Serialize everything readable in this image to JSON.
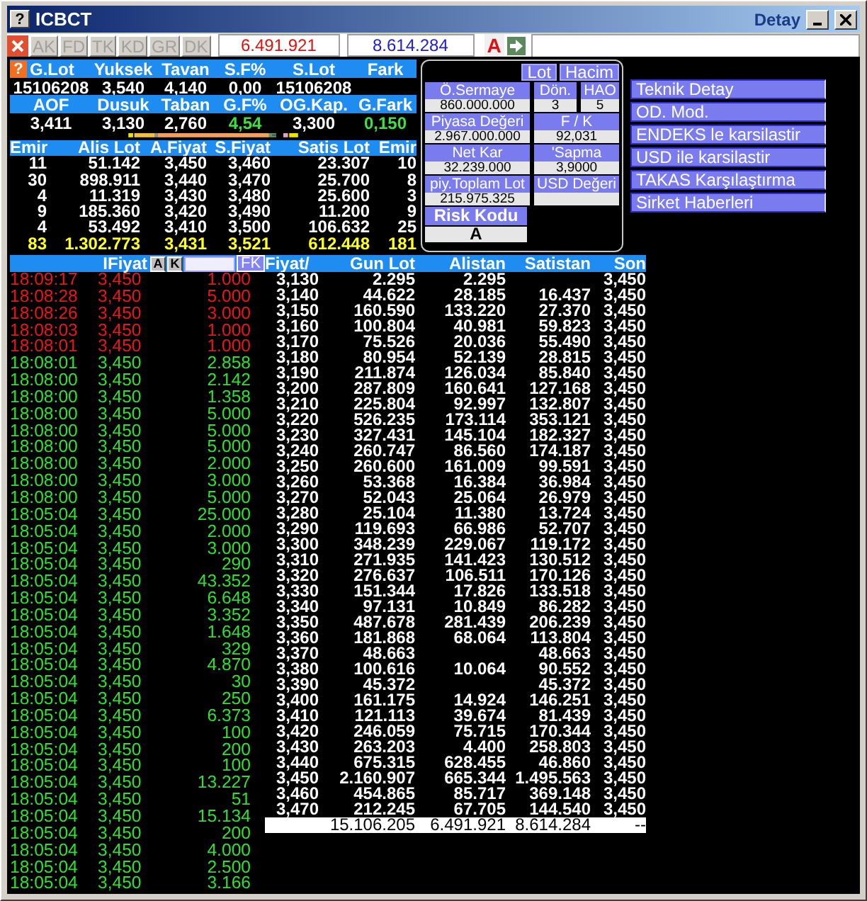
{
  "window": {
    "help": "?",
    "title": "ICBCT",
    "subtitle": "Detay"
  },
  "summary_help": "?",
  "toolbar": {
    "buttons": [
      {
        "label": "AK",
        "disabled": true
      },
      {
        "label": "FD",
        "disabled": true
      },
      {
        "label": "TK",
        "disabled": true
      },
      {
        "label": "KD",
        "disabled": true
      },
      {
        "label": "GR",
        "disabled": true
      },
      {
        "label": "DK",
        "disabled": true
      }
    ],
    "buy_total": "6.491.921",
    "sell_total": "8.614.284",
    "flag": "A"
  },
  "summary": [
    {
      "headers": [
        "G.Lot",
        "Yuksek",
        "Tavan",
        "S.F%",
        "S.Lot",
        "Fark"
      ],
      "values": [
        {
          "text": "15106208",
          "kind": "plain"
        },
        {
          "text": "3,540",
          "kind": "plain"
        },
        {
          "text": "4,140",
          "kind": "plain"
        },
        {
          "text": "0,00",
          "kind": "plain"
        },
        {
          "text": "15106208",
          "kind": "plain"
        }
      ]
    },
    {
      "headers": [
        "AOF",
        "Dusuk",
        "Taban",
        "G.F%",
        "OG.Kap.",
        "G.Fark"
      ],
      "values": [
        {
          "text": "3,411",
          "kind": "plain"
        },
        {
          "text": "3,130",
          "kind": "plain"
        },
        {
          "text": "2,760",
          "kind": "plain"
        },
        {
          "text": "4,54",
          "kind": "up"
        },
        {
          "text": "3,300",
          "kind": "plain"
        },
        {
          "text": "0,150",
          "kind": "up"
        }
      ]
    }
  ],
  "depth": {
    "columns": [
      "Emir",
      "Alis Lot",
      "A.Fiyat",
      "S.Fiyat",
      "Satis Lot",
      "Emir"
    ],
    "rows": [
      [
        "11",
        "51.142",
        "3,450",
        "3,460",
        "23.307",
        "10"
      ],
      [
        "30",
        "898.911",
        "3,440",
        "3,470",
        "25.700",
        "8"
      ],
      [
        "4",
        "11.319",
        "3,430",
        "3,480",
        "25.600",
        "3"
      ],
      [
        "9",
        "185.360",
        "3,420",
        "3,490",
        "11.200",
        "9"
      ],
      [
        "4",
        "53.492",
        "3,410",
        "3,500",
        "106.632",
        "25"
      ]
    ],
    "total": [
      "83",
      "1.302.773",
      "3,431",
      "3,521",
      "612.448",
      "181"
    ]
  },
  "info_panel": {
    "toggles": [
      "Lot",
      "Hacim"
    ],
    "rows": [
      [
        {
          "label": "Ö.Sermaye",
          "value": "860.000.000"
        },
        {
          "label": "Dön.",
          "value": "3"
        },
        {
          "label": "HAO",
          "value": "5"
        }
      ],
      [
        {
          "label": "Piyasa Değeri",
          "value": "2.967.000.000"
        },
        {
          "label": "F / K",
          "value": "92,031"
        }
      ],
      [
        {
          "label": "Net Kar",
          "value": "32.239.000"
        },
        {
          "label": "'Sapma",
          "value": "3,9000"
        }
      ],
      [
        {
          "label": "piy.Toplam Lot",
          "value": "215.975.325"
        },
        {
          "label": "USD Değeri"
        }
      ]
    ],
    "risk": {
      "label": "Risk Kodu",
      "value": "A"
    }
  },
  "menu": [
    "Teknik Detay",
    "OD. Mod.",
    "ENDEKS le karsilastir",
    "USD ile karsilastir",
    "TAKAS Karşılaştırma",
    "Sirket Haberleri"
  ],
  "trades": {
    "header": "IFiyat",
    "buttons": [
      "A",
      "K"
    ],
    "filter_button": "FK",
    "rows": [
      {
        "time": "18:09:17",
        "price": "3,450",
        "lot": "1.000",
        "kind": "sell"
      },
      {
        "time": "18:08:28",
        "price": "3,450",
        "lot": "5.000",
        "kind": "sell"
      },
      {
        "time": "18:08:26",
        "price": "3,450",
        "lot": "3.000",
        "kind": "sell"
      },
      {
        "time": "18:08:03",
        "price": "3,450",
        "lot": "1.000",
        "kind": "sell"
      },
      {
        "time": "18:08:01",
        "price": "3,450",
        "lot": "1.000",
        "kind": "sell"
      },
      {
        "time": "18:08:01",
        "price": "3,450",
        "lot": "2.858",
        "kind": "buy"
      },
      {
        "time": "18:08:00",
        "price": "3,450",
        "lot": "2.142",
        "kind": "buy"
      },
      {
        "time": "18:08:00",
        "price": "3,450",
        "lot": "1.358",
        "kind": "buy"
      },
      {
        "time": "18:08:00",
        "price": "3,450",
        "lot": "5.000",
        "kind": "buy"
      },
      {
        "time": "18:08:00",
        "price": "3,450",
        "lot": "5.000",
        "kind": "buy"
      },
      {
        "time": "18:08:00",
        "price": "3,450",
        "lot": "5.000",
        "kind": "buy"
      },
      {
        "time": "18:08:00",
        "price": "3,450",
        "lot": "2.000",
        "kind": "buy"
      },
      {
        "time": "18:08:00",
        "price": "3,450",
        "lot": "3.000",
        "kind": "buy"
      },
      {
        "time": "18:08:00",
        "price": "3,450",
        "lot": "5.000",
        "kind": "buy"
      },
      {
        "time": "18:05:04",
        "price": "3,450",
        "lot": "25.000",
        "kind": "buy"
      },
      {
        "time": "18:05:04",
        "price": "3,450",
        "lot": "2.000",
        "kind": "buy"
      },
      {
        "time": "18:05:04",
        "price": "3,450",
        "lot": "3.000",
        "kind": "buy"
      },
      {
        "time": "18:05:04",
        "price": "3,450",
        "lot": "290",
        "kind": "buy"
      },
      {
        "time": "18:05:04",
        "price": "3,450",
        "lot": "43.352",
        "kind": "buy"
      },
      {
        "time": "18:05:04",
        "price": "3,450",
        "lot": "6.648",
        "kind": "buy"
      },
      {
        "time": "18:05:04",
        "price": "3,450",
        "lot": "3.352",
        "kind": "buy"
      },
      {
        "time": "18:05:04",
        "price": "3,450",
        "lot": "1.648",
        "kind": "buy"
      },
      {
        "time": "18:05:04",
        "price": "3,450",
        "lot": "329",
        "kind": "buy"
      },
      {
        "time": "18:05:04",
        "price": "3,450",
        "lot": "4.870",
        "kind": "buy"
      },
      {
        "time": "18:05:04",
        "price": "3,450",
        "lot": "30",
        "kind": "buy"
      },
      {
        "time": "18:05:04",
        "price": "3,450",
        "lot": "250",
        "kind": "buy"
      },
      {
        "time": "18:05:04",
        "price": "3,450",
        "lot": "6.373",
        "kind": "buy"
      },
      {
        "time": "18:05:04",
        "price": "3,450",
        "lot": "100",
        "kind": "buy"
      },
      {
        "time": "18:05:04",
        "price": "3,450",
        "lot": "200",
        "kind": "buy"
      },
      {
        "time": "18:05:04",
        "price": "3,450",
        "lot": "100",
        "kind": "buy"
      },
      {
        "time": "18:05:04",
        "price": "3,450",
        "lot": "13.227",
        "kind": "buy"
      },
      {
        "time": "18:05:04",
        "price": "3,450",
        "lot": "51",
        "kind": "buy"
      },
      {
        "time": "18:05:04",
        "price": "3,450",
        "lot": "15.134",
        "kind": "buy"
      },
      {
        "time": "18:05:04",
        "price": "3,450",
        "lot": "200",
        "kind": "buy"
      },
      {
        "time": "18:05:04",
        "price": "3,450",
        "lot": "4.000",
        "kind": "buy"
      },
      {
        "time": "18:05:04",
        "price": "3,450",
        "lot": "2.500",
        "kind": "buy"
      },
      {
        "time": "18:05:04",
        "price": "3,450",
        "lot": "3.166",
        "kind": "buy"
      }
    ]
  },
  "price_table": {
    "columns": [
      "Fiyat/",
      "Gun Lot",
      "Alistan",
      "Satistan",
      "Son"
    ],
    "rows": [
      [
        "3,130",
        "2.295",
        "2.295",
        "",
        "3,450"
      ],
      [
        "3,140",
        "44.622",
        "28.185",
        "16.437",
        "3,450"
      ],
      [
        "3,150",
        "160.590",
        "133.220",
        "27.370",
        "3,450"
      ],
      [
        "3,160",
        "100.804",
        "40.981",
        "59.823",
        "3,450"
      ],
      [
        "3,170",
        "75.526",
        "20.036",
        "55.490",
        "3,450"
      ],
      [
        "3,180",
        "80.954",
        "52.139",
        "28.815",
        "3,450"
      ],
      [
        "3,190",
        "211.874",
        "126.034",
        "85.840",
        "3,450"
      ],
      [
        "3,200",
        "287.809",
        "160.641",
        "127.168",
        "3,450"
      ],
      [
        "3,210",
        "225.804",
        "92.997",
        "132.807",
        "3,450"
      ],
      [
        "3,220",
        "526.235",
        "173.114",
        "353.121",
        "3,450"
      ],
      [
        "3,230",
        "327.431",
        "145.104",
        "182.327",
        "3,450"
      ],
      [
        "3,240",
        "260.747",
        "86.560",
        "174.187",
        "3,450"
      ],
      [
        "3,250",
        "260.600",
        "161.009",
        "99.591",
        "3,450"
      ],
      [
        "3,260",
        "53.368",
        "16.384",
        "36.984",
        "3,450"
      ],
      [
        "3,270",
        "52.043",
        "25.064",
        "26.979",
        "3,450"
      ],
      [
        "3,280",
        "25.104",
        "11.380",
        "13.724",
        "3,450"
      ],
      [
        "3,290",
        "119.693",
        "66.986",
        "52.707",
        "3,450"
      ],
      [
        "3,300",
        "348.239",
        "229.067",
        "119.172",
        "3,450"
      ],
      [
        "3,310",
        "271.935",
        "141.423",
        "130.512",
        "3,450"
      ],
      [
        "3,320",
        "276.637",
        "106.511",
        "170.126",
        "3,450"
      ],
      [
        "3,330",
        "151.344",
        "17.826",
        "133.518",
        "3,450"
      ],
      [
        "3,340",
        "97.131",
        "10.849",
        "86.282",
        "3,450"
      ],
      [
        "3,350",
        "487.678",
        "281.439",
        "206.239",
        "3,450"
      ],
      [
        "3,360",
        "181.868",
        "68.064",
        "113.804",
        "3,450"
      ],
      [
        "3,370",
        "48.663",
        "",
        "48.663",
        "3,450"
      ],
      [
        "3,380",
        "100.616",
        "10.064",
        "90.552",
        "3,450"
      ],
      [
        "3,390",
        "45.372",
        "",
        "45.372",
        "3,450"
      ],
      [
        "3,400",
        "161.175",
        "14.924",
        "146.251",
        "3,450"
      ],
      [
        "3,410",
        "121.113",
        "39.674",
        "81.439",
        "3,450"
      ],
      [
        "3,420",
        "246.059",
        "75.715",
        "170.344",
        "3,450"
      ],
      [
        "3,430",
        "263.203",
        "4.400",
        "258.803",
        "3,450"
      ],
      [
        "3,440",
        "675.315",
        "628.455",
        "46.860",
        "3,450"
      ],
      [
        "3,450",
        "2.160.907",
        "665.344",
        "1.495.563",
        "3,450"
      ],
      [
        "3,460",
        "454.865",
        "85.717",
        "369.148",
        "3,450"
      ],
      [
        "3,470",
        "212.245",
        "67.705",
        "144.540",
        "3,450"
      ]
    ],
    "total": {
      "gun_lot": "15.106.205",
      "alistan": "6.491.921",
      "satistan": "8.614.284",
      "son": "--"
    }
  }
}
